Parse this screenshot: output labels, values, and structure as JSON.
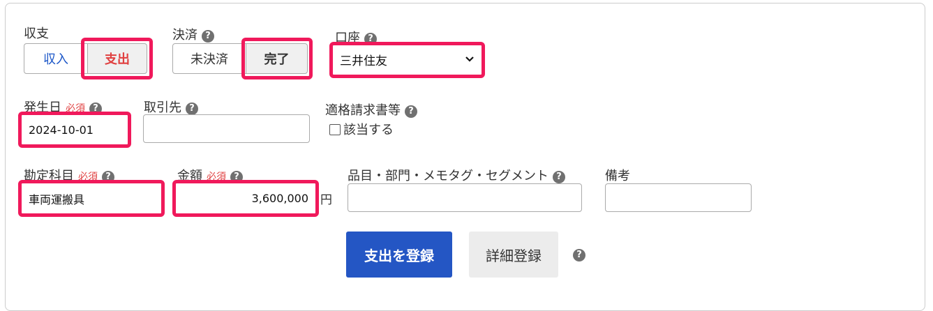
{
  "fields": {
    "shushi": {
      "label": "収支",
      "options": [
        "収入",
        "支出"
      ],
      "selected": "支出"
    },
    "kessai": {
      "label": "決済",
      "options": [
        "未決済",
        "完了"
      ],
      "selected": "完了"
    },
    "koza": {
      "label": "口座",
      "value": "三井住友"
    },
    "hasseibi": {
      "label": "発生日",
      "required": "必須",
      "value": "2024-10-01"
    },
    "torihikisaki": {
      "label": "取引先",
      "value": ""
    },
    "tekikaku": {
      "label": "適格請求書等",
      "checkbox_label": "該当する",
      "checked": false
    },
    "kanjo": {
      "label": "勘定科目",
      "required": "必須",
      "value": "車両運搬具"
    },
    "kingaku": {
      "label": "金額",
      "required": "必須",
      "value": "3,600,000",
      "unit": "円"
    },
    "hinmoku": {
      "label": "品目・部門・メモタグ・セグメント",
      "value": ""
    },
    "biko": {
      "label": "備考",
      "value": ""
    }
  },
  "actions": {
    "submit_label": "支出を登録",
    "detail_label": "詳細登録"
  },
  "help_glyph": "?",
  "colors": {
    "highlight": "#f0195b",
    "primary": "#2456c4",
    "expense_red": "#e04040",
    "income_blue": "#1a56c8"
  }
}
